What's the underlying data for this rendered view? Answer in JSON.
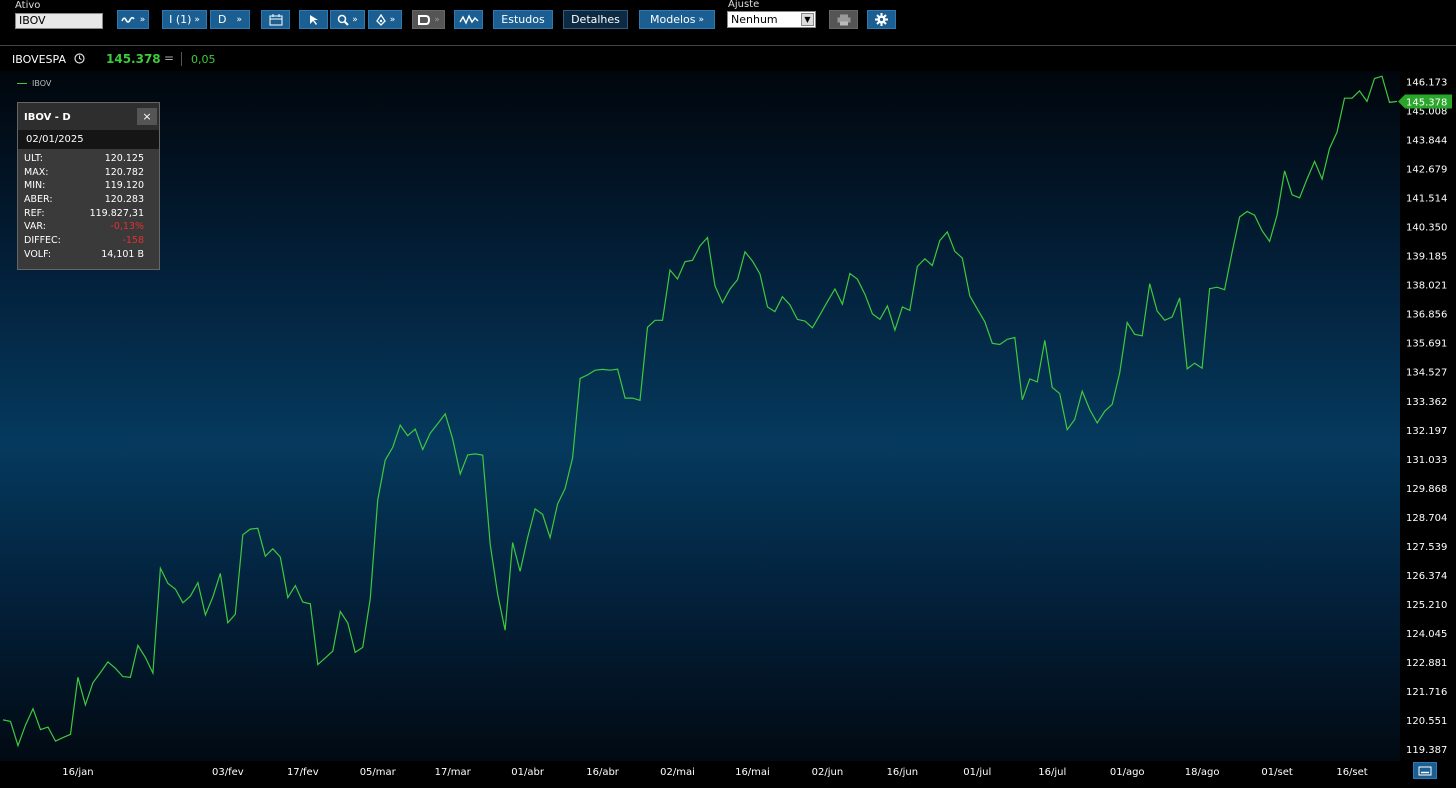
{
  "toolbar": {
    "ativo_label": "Ativo",
    "ativo_value": "IBOV",
    "interval_label": "I (1)",
    "period_label": "D",
    "estudos_label": "Estudos",
    "detalhes_label": "Detalhes",
    "modelos_label": "Modelos",
    "ajuste_label": "Ajuste",
    "ajuste_value": "Nenhum",
    "icons": [
      "chart-type-icon",
      "calendar-icon",
      "cursor-icon",
      "zoom-icon",
      "draw-pen-icon",
      "magnet-icon",
      "studies-wave-icon",
      "print-icon",
      "gear-icon"
    ]
  },
  "quote": {
    "symbol": "IBOVESPA",
    "last": "145.378",
    "direction_symbol": "=",
    "change": "0,05",
    "up_color": "#3ec93e"
  },
  "legend": {
    "series_name": "IBOV"
  },
  "info_panel": {
    "title": "IBOV - D",
    "close_glyph": "×",
    "date": "02/01/2025",
    "rows": [
      {
        "key": "ULT:",
        "value": "120.125"
      },
      {
        "key": "MAX:",
        "value": "120.782"
      },
      {
        "key": "MIN:",
        "value": "119.120"
      },
      {
        "key": "ABER:",
        "value": "120.283"
      },
      {
        "key": "REF:",
        "value": "119.827,31"
      },
      {
        "key": "VAR:",
        "value": "-0,13%"
      },
      {
        "key": "DIFFEC:",
        "value": "-158"
      },
      {
        "key": "VOLF:",
        "value": "14,101 B"
      }
    ],
    "negative_color": "#e03030"
  },
  "chart_data": {
    "type": "line",
    "series": [
      {
        "name": "IBOV",
        "color": "#3ec93e",
        "values": [
          120.55,
          120.49,
          119.52,
          120.34,
          121.0,
          120.16,
          120.26,
          119.7,
          119.84,
          119.97,
          122.26,
          121.15,
          122.04,
          122.45,
          122.88,
          122.62,
          122.29,
          122.26,
          123.54,
          123.06,
          122.43,
          126.64,
          126.03,
          125.8,
          125.25,
          125.52,
          126.06,
          124.76,
          125.48,
          126.43,
          124.45,
          124.79,
          127.98,
          128.21,
          128.24,
          127.12,
          127.42,
          127.09,
          125.46,
          125.94,
          125.28,
          125.21,
          122.77,
          123.04,
          123.31,
          124.9,
          124.44,
          123.26,
          123.46,
          125.4,
          129.37,
          130.98,
          131.49,
          132.38,
          131.96,
          132.23,
          131.4,
          132.06,
          132.44,
          132.84,
          131.82,
          130.42,
          131.19,
          131.23,
          131.18,
          127.6,
          125.61,
          124.15,
          127.67,
          126.51,
          127.87,
          129.02,
          128.8,
          127.87,
          129.22,
          129.84,
          131.07,
          134.26,
          134.4,
          134.59,
          134.62,
          134.59,
          134.63,
          133.47,
          133.47,
          133.38,
          136.31,
          136.59,
          136.59,
          138.61,
          138.25,
          138.95,
          139.0,
          139.58,
          139.91,
          137.97,
          137.3,
          137.85,
          138.22,
          139.34,
          138.97,
          138.45,
          137.13,
          136.94,
          137.54,
          137.21,
          136.63,
          136.56,
          136.29,
          136.81,
          137.34,
          137.85,
          137.24,
          138.47,
          138.24,
          137.64,
          136.85,
          136.63,
          137.17,
          136.2,
          137.13,
          136.99,
          138.75,
          139.06,
          138.79,
          139.79,
          140.14,
          139.36,
          139.09,
          137.57,
          137.05,
          136.53,
          135.67,
          135.62,
          135.83,
          135.9,
          133.4,
          134.24,
          134.12,
          135.79,
          133.9,
          133.65,
          132.2,
          132.61,
          133.75,
          133.01,
          132.47,
          132.94,
          133.22,
          134.48,
          136.5,
          136.03,
          135.97,
          138.06,
          136.96,
          136.59,
          136.73,
          137.49,
          134.64,
          134.87,
          134.67,
          137.86,
          137.92,
          137.82,
          139.33,
          140.74,
          140.96,
          140.81,
          140.19,
          139.76,
          140.82,
          142.59,
          141.63,
          141.51,
          142.27,
          142.97,
          142.26,
          143.49,
          144.14,
          145.51,
          145.51,
          145.8,
          145.38,
          146.3,
          146.39,
          145.34,
          145.38
        ],
        "last_value": 145.378
      }
    ],
    "x_tick_labels": [
      "16/jan",
      "03/fev",
      "17/fev",
      "05/mar",
      "17/mar",
      "01/abr",
      "16/abr",
      "02/mai",
      "16/mai",
      "02/jun",
      "16/jun",
      "01/jul",
      "16/jul",
      "01/ago",
      "18/ago",
      "01/set",
      "16/set"
    ],
    "x_tick_index": [
      10,
      30,
      40,
      50,
      60,
      70,
      80,
      90,
      100,
      110,
      120,
      130,
      140,
      150,
      160,
      170,
      180
    ],
    "y_tick_labels": [
      "146.173",
      "145.008",
      "143.844",
      "142.679",
      "141.514",
      "140.350",
      "139.185",
      "138.021",
      "136.856",
      "135.691",
      "134.527",
      "133.362",
      "132.197",
      "131.033",
      "129.868",
      "128.704",
      "127.539",
      "126.374",
      "125.210",
      "124.045",
      "122.881",
      "121.716",
      "120.551",
      "119.387"
    ],
    "y_tick_values": [
      146.173,
      145.008,
      143.844,
      142.679,
      141.514,
      140.35,
      139.185,
      138.021,
      136.856,
      135.691,
      134.527,
      133.362,
      132.197,
      131.033,
      129.868,
      128.704,
      127.539,
      126.374,
      125.21,
      124.045,
      122.881,
      121.716,
      120.551,
      119.387
    ],
    "ylim": [
      118.9,
      146.6
    ],
    "grid": false,
    "legend": "top-left"
  }
}
